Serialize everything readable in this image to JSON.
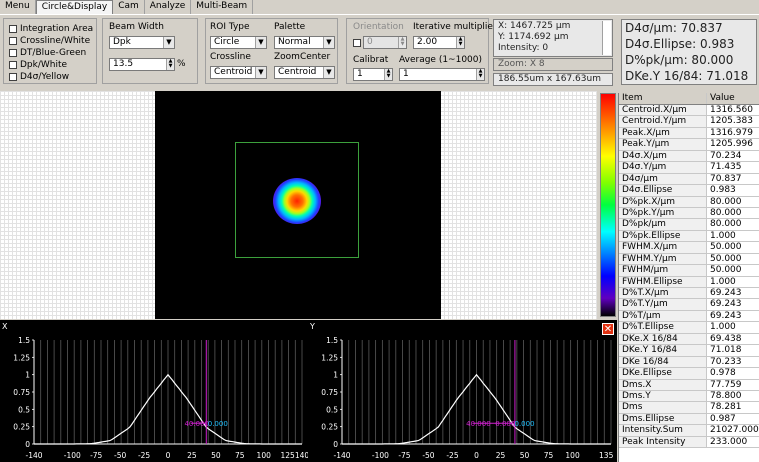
{
  "tabs": [
    "Menu",
    "Circle&Display",
    "Cam",
    "Analyze",
    "Multi-Beam"
  ],
  "active_tab": "Circle&Display",
  "overlays": [
    "Integration Area",
    "Crossline/White",
    "DT/Blue-Green",
    "Dpk/White",
    "D4σ/Yellow"
  ],
  "beam_width": {
    "title": "Beam Width",
    "method": "Dpk",
    "value": "13.5",
    "unit": "%"
  },
  "roi": {
    "type_title": "ROI Type",
    "type": "Circle",
    "crossline_title": "Crossline",
    "crossline": "Centroid"
  },
  "palette": {
    "title": "Palette",
    "value": "Normal",
    "zoom_center_title": "ZoomCenter",
    "zoom_center": "Centroid"
  },
  "orientation": {
    "title": "Orientation",
    "value": "0"
  },
  "iterative": {
    "title": "Iterative multiplier",
    "value": "2.00"
  },
  "calibrat": {
    "title": "Calibrat",
    "value": "1"
  },
  "average": {
    "title": "Average (1~1000)",
    "value": "1"
  },
  "coords": {
    "x": "X:  1467.725 μm",
    "y": "Y:  1174.692 μm",
    "intensity": "Intensity:    0"
  },
  "zoom": "Zoom: X 8",
  "size": "186.55um x 167.63um",
  "big": {
    "l1": "D4σ/μm: 70.837",
    "l2": "D4σ.Ellipse: 0.983",
    "l3": "D%pk/μm: 80.000",
    "l4": "DKe.Y 16/84: 71.018"
  },
  "results": {
    "header_item": "Item",
    "header_value": "Value",
    "rows": [
      [
        "Centroid.X/μm",
        "1316.560"
      ],
      [
        "Centroid.Y/μm",
        "1205.383"
      ],
      [
        "Peak.X/μm",
        "1316.979"
      ],
      [
        "Peak.Y/μm",
        "1205.996"
      ],
      [
        "D4σ.X/μm",
        "70.234"
      ],
      [
        "D4σ.Y/μm",
        "71.435"
      ],
      [
        "D4σ/μm",
        "70.837"
      ],
      [
        "D4σ.Ellipse",
        "0.983"
      ],
      [
        "D%pk.X/μm",
        "80.000"
      ],
      [
        "D%pk.Y/μm",
        "80.000"
      ],
      [
        "D%pk/μm",
        "80.000"
      ],
      [
        "D%pk.Ellipse",
        "1.000"
      ],
      [
        "FWHM.X/μm",
        "50.000"
      ],
      [
        "FWHM.Y/μm",
        "50.000"
      ],
      [
        "FWHM/μm",
        "50.000"
      ],
      [
        "FWHM.Ellipse",
        "1.000"
      ],
      [
        "D%T.X/μm",
        "69.243"
      ],
      [
        "D%T.Y/μm",
        "69.243"
      ],
      [
        "D%T/μm",
        "69.243"
      ],
      [
        "D%T.Ellipse",
        "1.000"
      ],
      [
        "DKe.X 16/84",
        "69.438"
      ],
      [
        "DKe.Y 16/84",
        "71.018"
      ],
      [
        "DKe 16/84",
        "70.233"
      ],
      [
        "DKe.Ellipse",
        "0.978"
      ],
      [
        "Dms.X",
        "77.759"
      ],
      [
        "Dms.Y",
        "78.800"
      ],
      [
        "Dms",
        "78.281"
      ],
      [
        "Dms.Ellipse",
        "0.987"
      ],
      [
        "Intensity.Sum",
        "21027.000"
      ],
      [
        "Peak Intensity",
        "233.000"
      ]
    ]
  },
  "close_glyph": "✕",
  "chart_data": [
    {
      "type": "line",
      "axis_label": "X",
      "x": [
        -140,
        -120,
        -100,
        -80,
        -60,
        -40,
        -20,
        0,
        20,
        40,
        60,
        80,
        100,
        120,
        140
      ],
      "y": [
        0,
        0,
        0,
        0.005,
        0.05,
        0.24,
        0.65,
        1.0,
        0.65,
        0.24,
        0.05,
        0.005,
        0,
        0,
        0
      ],
      "xticks": [
        "-140",
        "-100",
        "-75",
        "-50",
        "-25",
        "0",
        "25",
        "50",
        "75",
        "100",
        "125",
        "140"
      ],
      "xtick_vals": [
        -140,
        -100,
        -75,
        -50,
        -25,
        0,
        25,
        50,
        75,
        100,
        125,
        140
      ],
      "ylim": [
        0,
        1.5
      ],
      "yticks": [
        "0",
        "0.25",
        "0.5",
        "0.75",
        "1",
        "1.25",
        "1.5"
      ],
      "marker_x": 40,
      "labels": [
        "40.000",
        "0.000"
      ],
      "label_x": [
        30,
        52
      ]
    },
    {
      "type": "line",
      "axis_label": "Y",
      "x": [
        -140,
        -120,
        -100,
        -80,
        -60,
        -40,
        -20,
        0,
        20,
        40,
        60,
        80,
        100,
        120,
        140
      ],
      "y": [
        0,
        0,
        0,
        0.005,
        0.05,
        0.24,
        0.65,
        1.0,
        0.65,
        0.24,
        0.05,
        0.005,
        0,
        0,
        0
      ],
      "xticks": [
        "-140",
        "-100",
        "-75",
        "-50",
        "-25",
        "0",
        "25",
        "50",
        "75",
        "100",
        "135"
      ],
      "xtick_vals": [
        -140,
        -100,
        -75,
        -50,
        -25,
        0,
        25,
        50,
        75,
        100,
        135
      ],
      "ylim": [
        0,
        1.5
      ],
      "yticks": [
        "0",
        "0.25",
        "0.5",
        "0.75",
        "1",
        "1.25",
        "1.5"
      ],
      "marker_x": 40,
      "labels": [
        "40.000",
        "0.000",
        "0.000"
      ],
      "label_x": [
        2,
        30,
        50
      ]
    }
  ]
}
